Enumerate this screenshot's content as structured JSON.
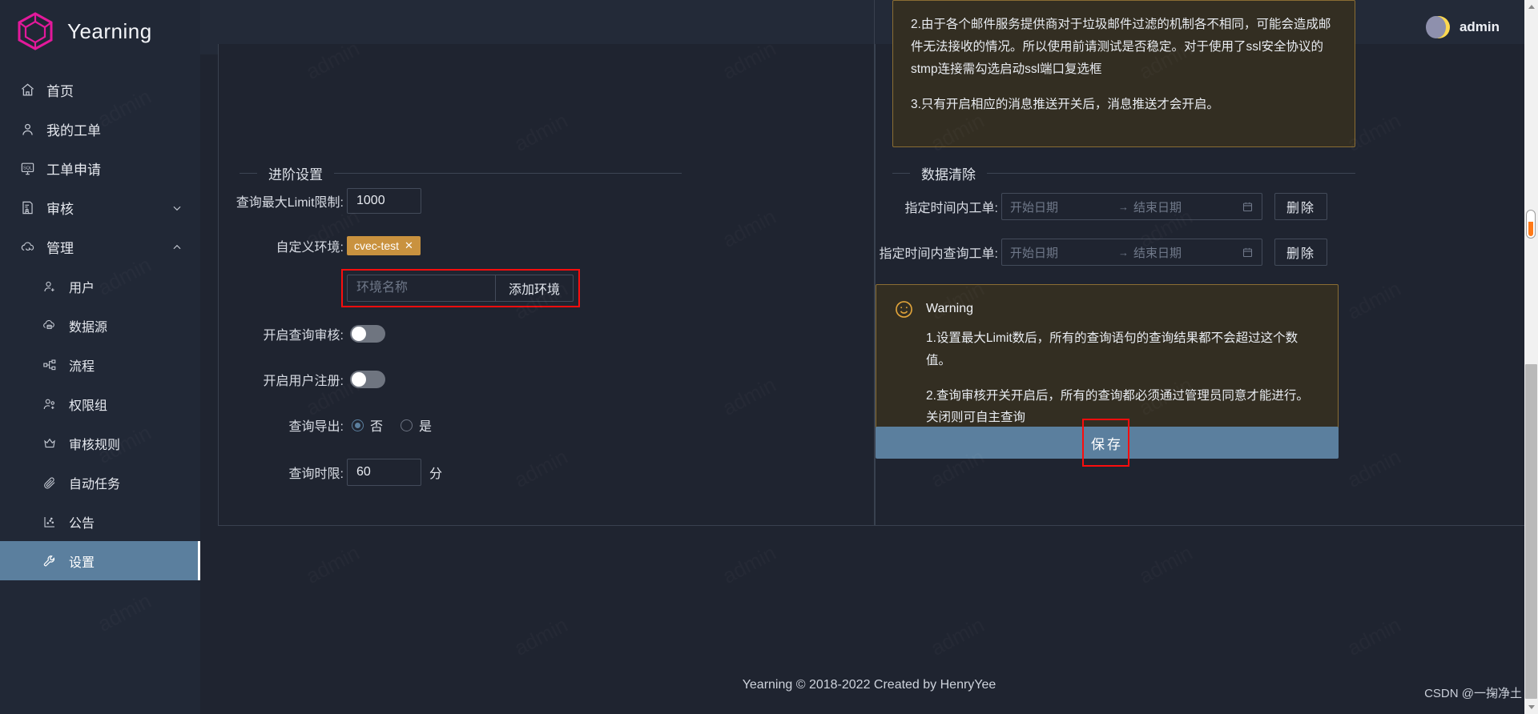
{
  "brand": {
    "name": "Yearning",
    "logo_icon": "hexagon-logo-icon"
  },
  "topbar": {
    "username": "admin",
    "avatar_icon": "moon-avatar"
  },
  "sidebar": {
    "items": [
      {
        "label": "首页",
        "icon": "home-icon",
        "type": "top",
        "active": false,
        "chevron": ""
      },
      {
        "label": "我的工单",
        "icon": "user-icon",
        "type": "top",
        "active": false,
        "chevron": ""
      },
      {
        "label": "工单申请",
        "icon": "sql-monitor-icon",
        "type": "top",
        "active": false,
        "chevron": ""
      },
      {
        "label": "审核",
        "icon": "audit-doc-icon",
        "type": "top",
        "active": false,
        "chevron": "down"
      },
      {
        "label": "管理",
        "icon": "cloud-sync-icon",
        "type": "top",
        "active": false,
        "chevron": "up"
      },
      {
        "label": "用户",
        "icon": "user-add-icon",
        "type": "sub",
        "active": false,
        "chevron": ""
      },
      {
        "label": "数据源",
        "icon": "database-cloud-icon",
        "type": "sub",
        "active": false,
        "chevron": ""
      },
      {
        "label": "流程",
        "icon": "flow-chart-icon",
        "type": "sub",
        "active": false,
        "chevron": ""
      },
      {
        "label": "权限组",
        "icon": "user-group-icon",
        "type": "sub",
        "active": false,
        "chevron": ""
      },
      {
        "label": "审核规则",
        "icon": "crown-icon",
        "type": "sub",
        "active": false,
        "chevron": ""
      },
      {
        "label": "自动任务",
        "icon": "paperclip-icon",
        "type": "sub",
        "active": false,
        "chevron": ""
      },
      {
        "label": "公告",
        "icon": "chart-icon",
        "type": "sub",
        "active": false,
        "chevron": ""
      },
      {
        "label": "设置",
        "icon": "wrench-icon",
        "type": "sub",
        "active": true,
        "chevron": ""
      }
    ]
  },
  "left_panel": {
    "section_title": "进阶设置",
    "limit_label": "查询最大Limit限制:",
    "limit_value": "1000",
    "env_label": "自定义环境:",
    "env_tags": [
      {
        "name": "cvec-test",
        "close": "✕"
      }
    ],
    "env_input_placeholder": "环境名称",
    "env_add_button": "添加环境",
    "query_audit_label": "开启查询审核:",
    "query_audit_on": false,
    "user_register_label": "开启用户注册:",
    "user_register_on": false,
    "export_label": "查询导出:",
    "export_options": [
      {
        "label": "否",
        "selected": true
      },
      {
        "label": "是",
        "selected": false
      }
    ],
    "time_limit_label": "查询时限:",
    "time_limit_value": "60",
    "time_limit_unit": "分"
  },
  "right_panel": {
    "info_alert": {
      "line1": "2.由于各个邮件服务提供商对于垃圾邮件过滤的机制各不相同，可能会造成邮件无法接收的情况。所以使用前请测试是否稳定。对于使用了ssl安全协议的stmp连接需勾选启动ssl端口复选框",
      "line2": "3.只有开启相应的消息推送开关后，消息推送才会开启。"
    },
    "section_title": "数据清除",
    "rows": [
      {
        "label": "指定时间内工单:",
        "start_placeholder": "开始日期",
        "arrow": "→",
        "end_placeholder": "结束日期",
        "calendar_icon": "calendar-icon",
        "delete_button": "删除"
      },
      {
        "label": "指定时间内查询工单:",
        "start_placeholder": "开始日期",
        "arrow": "→",
        "end_placeholder": "结束日期",
        "calendar_icon": "calendar-icon",
        "delete_button": "删除"
      }
    ],
    "warning": {
      "icon": "smiley-icon",
      "title": "Warning",
      "line1": "1.设置最大Limit数后，所有的查询语句的查询结果都不会超过这个数值。",
      "line2": "2.查询审核开关开启后，所有的查询都必须通过管理员同意才能进行。关闭则可自主查询"
    },
    "save_button": "保存"
  },
  "footer": {
    "text": "Yearning © 2018-2022 Created by HenryYee"
  },
  "watermark": {
    "text": "admin",
    "csdn": "CSDN @一掬净土"
  },
  "colors": {
    "sidebar_bg": "#212836",
    "content_bg": "#1f2430",
    "accent": "#5b7f9e",
    "brand_pink": "#e3199b",
    "tag_gold": "#c9923f",
    "alert_border": "#8a6d33",
    "alert_bg": "#332e22",
    "annotation_red": "#fb0d0d",
    "scroll_mark_orange": "#ff7a18"
  }
}
